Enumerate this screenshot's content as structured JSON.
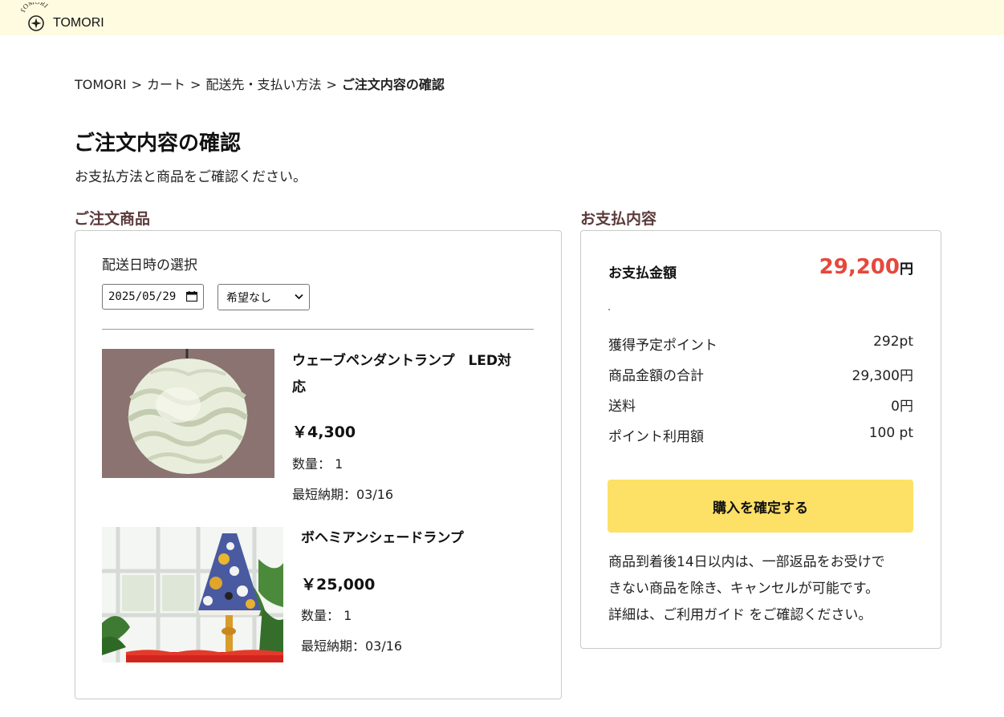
{
  "header": {
    "logo_arc_text": "TOMORI",
    "brand": "TOMORI",
    "bg_color": "#fffbe0"
  },
  "breadcrumb": {
    "items": [
      "TOMORI",
      "カート",
      "配送先・支払い方法"
    ],
    "current": "ご注文内容の確認",
    "separator": ">"
  },
  "page": {
    "title": "ご注文内容の確認",
    "subtitle": "お支払方法と商品をご確認ください。"
  },
  "order": {
    "heading": "ご注文商品",
    "delivery_label": "配送日時の選択",
    "date_value": "2025/05/29",
    "time_select_value": "希望なし",
    "items": [
      {
        "name_line1": "ウェーブペンダントランプ　LED対",
        "name_line2": "応",
        "price": "￥4,300",
        "quantity": "数量： 1",
        "delivery": "最短納期：03/16",
        "image_icon": "pendant-lamp-image"
      },
      {
        "name_line1": "ボヘミアンシェードランプ",
        "price": "￥25,000",
        "quantity": "数量： 1",
        "delivery": "最短納期：03/16",
        "image_icon": "shade-lamp-image"
      }
    ]
  },
  "payment": {
    "heading": "お支払内容",
    "total_label": "お支払金額",
    "total_value": "29,200",
    "total_unit": "円",
    "accent_color": "#e5483d",
    "rows": [
      {
        "label": "獲得予定ポイント",
        "value": "292pt"
      },
      {
        "label": "商品金額の合計",
        "value": "29,300円"
      },
      {
        "label": "送料",
        "value": "0円"
      },
      {
        "label": "ポイント利用額",
        "value": "100 pt"
      }
    ],
    "confirm_label": "購入を確定する",
    "button_color": "#fde066",
    "policy_line1": "商品到着後14日以内は、一部返品をお受けで",
    "policy_line2": "きない商品を除き、キャンセルが可能です。",
    "policy_line3": "詳細は、ご利用ガイド をご確認ください。"
  }
}
